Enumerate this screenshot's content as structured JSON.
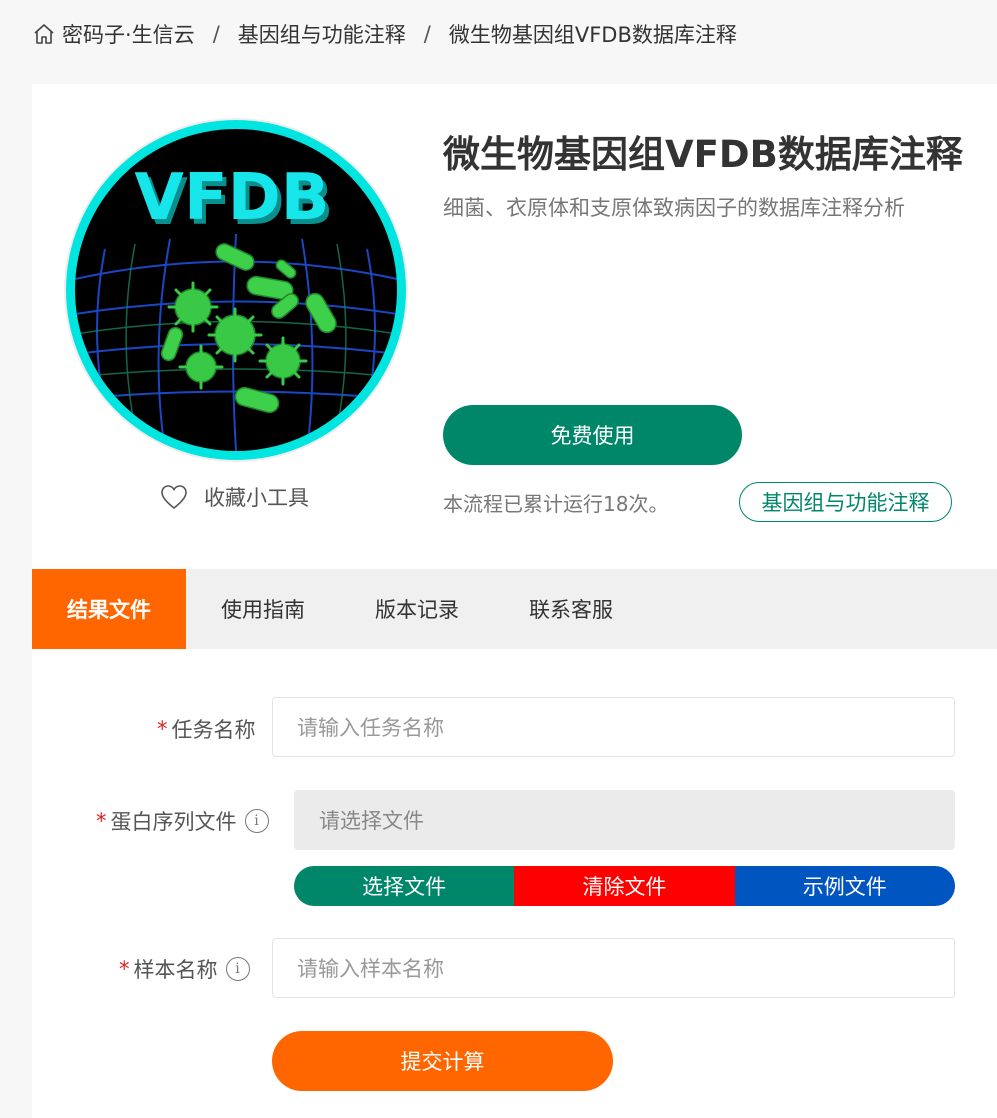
{
  "breadcrumb": {
    "items": [
      "密码子·生信云",
      "基因组与功能注释",
      "微生物基因组VFDB数据库注释"
    ],
    "separator": "/"
  },
  "logo": {
    "text": "VFDB",
    "ring_color": "#00e5e0"
  },
  "favorite": {
    "label": "收藏小工具"
  },
  "tool": {
    "title": "微生物基因组VFDB数据库注释",
    "subtitle": "细菌、衣原体和支原体致病因子的数据库注释分析",
    "free_button": "免费使用",
    "runs_text": "本流程已累计运行18次。",
    "category_tag": "基因组与功能注释"
  },
  "tabs": [
    {
      "label": "结果文件",
      "active": true
    },
    {
      "label": "使用指南",
      "active": false
    },
    {
      "label": "版本记录",
      "active": false
    },
    {
      "label": "联系客服",
      "active": false
    }
  ],
  "form": {
    "task_name": {
      "required_mark": "*",
      "label": "任务名称",
      "placeholder": "请输入任务名称"
    },
    "protein_file": {
      "required_mark": "*",
      "label": "蛋白序列文件",
      "placeholder": "请选择文件"
    },
    "file_buttons": {
      "select": "选择文件",
      "clear": "清除文件",
      "example": "示例文件"
    },
    "sample_name": {
      "required_mark": "*",
      "label": "样本名称",
      "placeholder": "请输入样本名称"
    },
    "submit": "提交计算"
  },
  "colors": {
    "accent_green": "#00876a",
    "accent_orange": "#ff6600",
    "clear_red": "#ff0000",
    "example_blue": "#0055c0"
  }
}
